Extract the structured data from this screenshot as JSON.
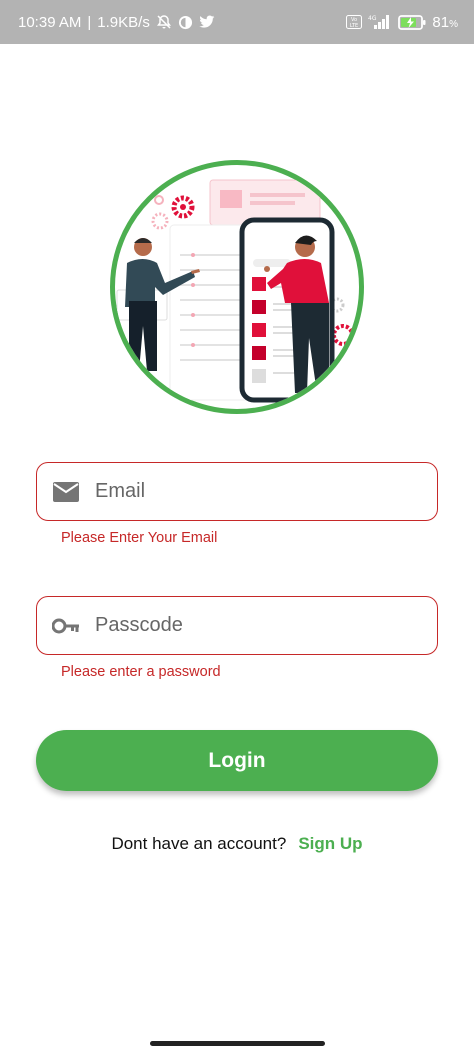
{
  "status_bar": {
    "time": "10:39 AM",
    "separator": "|",
    "net_speed": "1.9KB/s",
    "battery_percent": "81",
    "battery_unit": "%",
    "net_label": "4G",
    "volte_label": "Vo LTE"
  },
  "form": {
    "email_placeholder": "Email",
    "email_value": "",
    "email_error": "Please Enter Your Email",
    "password_placeholder": "Passcode",
    "password_value": "",
    "password_error": "Please enter a password"
  },
  "login_label": "Login",
  "signup": {
    "question": "Dont have an account?",
    "link": "Sign Up"
  },
  "colors": {
    "accent": "#4caf50",
    "error": "#c62828",
    "status_bar": "#b3b3b3"
  },
  "icons": {
    "email": "mail-icon",
    "password": "key-icon"
  }
}
